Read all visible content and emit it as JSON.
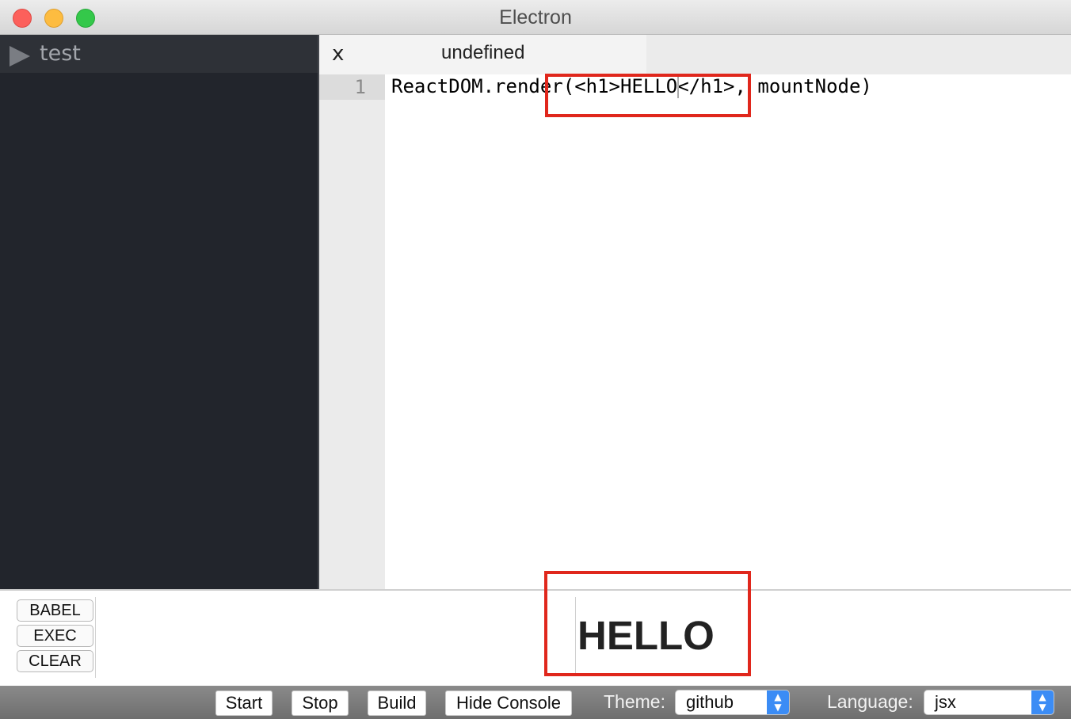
{
  "window": {
    "title": "Electron"
  },
  "sidebar": {
    "items": [
      {
        "label": "test",
        "icon": "triangle-right-icon"
      }
    ]
  },
  "tabs": [
    {
      "close_label": "x",
      "title": "undefined"
    }
  ],
  "editor": {
    "lines": [
      {
        "number": "1",
        "text": "ReactDOM.render(<h1>HELLO</h1>, mountNode)"
      }
    ]
  },
  "console": {
    "buttons": {
      "babel": "BABEL",
      "exec": "EXEC",
      "clear": "CLEAR"
    },
    "output": "HELLO"
  },
  "toolbar": {
    "start": "Start",
    "stop": "Stop",
    "build": "Build",
    "hide_console": "Hide Console",
    "theme_label": "Theme:",
    "theme_value": "github",
    "language_label": "Language:",
    "language_value": "jsx"
  },
  "colors": {
    "highlight": "#e0271c",
    "select_accent": "#3b8cf5",
    "sidebar_bg": "#22252c"
  }
}
